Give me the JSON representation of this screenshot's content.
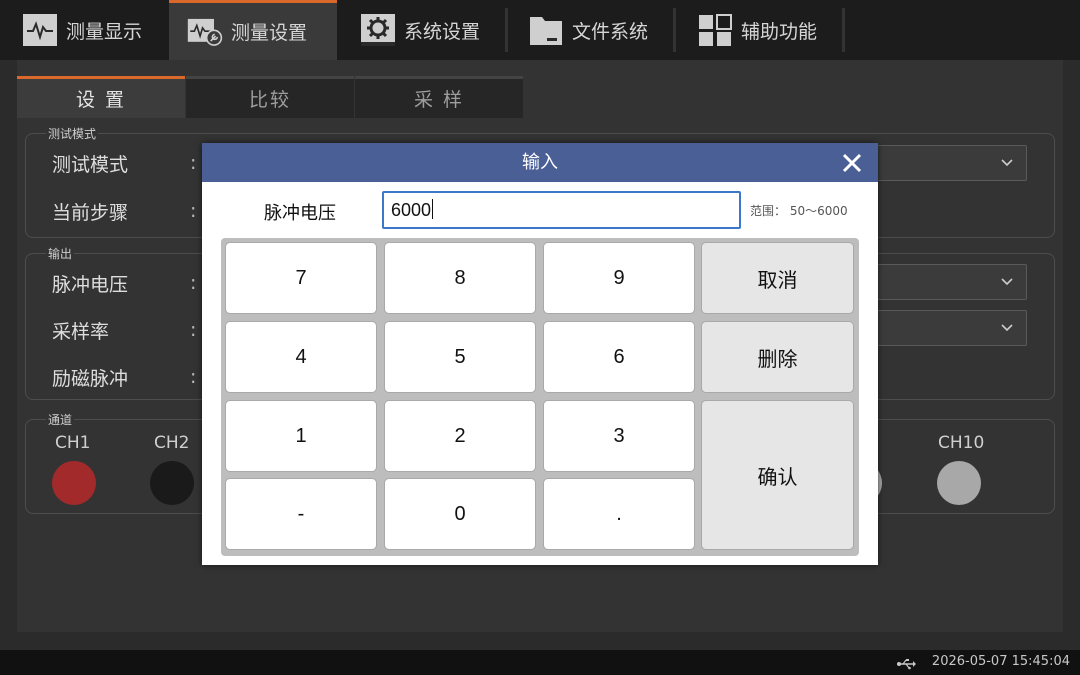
{
  "nav": {
    "tabs": [
      {
        "label": "测量显示",
        "icon": "waveform-icon",
        "active": false
      },
      {
        "label": "测量设置",
        "icon": "waveform-settings-icon",
        "active": true
      },
      {
        "label": "系统设置",
        "icon": "gear-icon",
        "active": false
      },
      {
        "label": "文件系统",
        "icon": "folder-icon",
        "active": false
      },
      {
        "label": "辅助功能",
        "icon": "grid-icon",
        "active": false
      }
    ]
  },
  "subtabs": [
    "设 置",
    "比较",
    "采 样"
  ],
  "groups": {
    "test_mode": {
      "title": "测试模式",
      "rows": [
        "测试模式",
        "当前步骤"
      ]
    },
    "output": {
      "title": "输出",
      "rows": [
        "脉冲电压",
        "采样率",
        "励磁脉冲"
      ]
    },
    "channel": {
      "title": "通道",
      "left_labels": [
        "CH1",
        "CH2"
      ],
      "right_label": "CH10"
    }
  },
  "colon": ":",
  "colors": {
    "accent": "#d9692a",
    "dialog_header": "#4a5f96",
    "ch1": "#a32a2a",
    "ch2": "#1a1a1a",
    "ch10": "#a8a8a8"
  },
  "dialog": {
    "title": "输入",
    "field_label": "脉冲电压",
    "value": "6000",
    "range": "范围： 50～6000",
    "keys": {
      "k7": "7",
      "k8": "8",
      "k9": "9",
      "k4": "4",
      "k5": "5",
      "k6": "6",
      "k1": "1",
      "k2": "2",
      "k3": "3",
      "kminus": "-",
      "k0": "0",
      "kdot": ".",
      "cancel": "取消",
      "delete": "删除",
      "confirm": "确认"
    }
  },
  "status": {
    "datetime": "2026-05-07 15:45:04"
  }
}
